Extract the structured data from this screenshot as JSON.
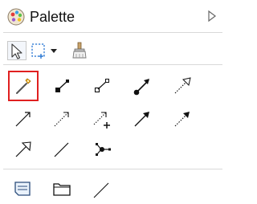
{
  "palette": {
    "title": "Palette",
    "icons": {
      "logo": "palette-logo-icon",
      "collapse": "collapse-arrow-icon"
    }
  },
  "toolbar": {
    "tools": [
      "select-tool",
      "marquee-tool",
      "marquee-dropdown",
      "format-painter-tool"
    ]
  },
  "connector_tools": [
    "create-connection-tool",
    "connector-filled-source",
    "connector-hollow-source",
    "connector-filled-target",
    "connector-open-target-dotted",
    "connector-arrow",
    "connector-dotted-arrow",
    "connector-add-dotted-arrow",
    "connector-bold-arrow",
    "connector-dashed-arrow",
    "connector-hollow-arrow",
    "connector-line",
    "connector-branch"
  ],
  "shape_tools": [
    "note-tool",
    "folder-tool",
    "line-tool"
  ],
  "colors": {
    "selected_border": "#e02020",
    "separator": "#d9d9d9",
    "icon": "#222222"
  }
}
